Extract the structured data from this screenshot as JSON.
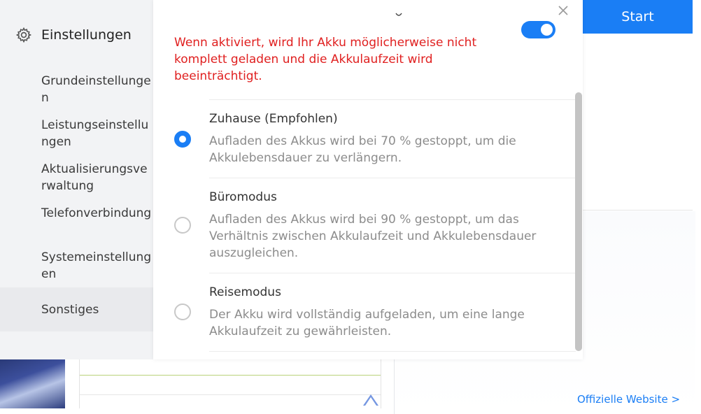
{
  "background": {
    "start_button": "Start",
    "official_link": "Offizielle Website >"
  },
  "sidebar": {
    "title": "Einstellungen",
    "items": [
      {
        "label": "Grundeinstellungen"
      },
      {
        "label": "Leistungseinstellungen"
      },
      {
        "label": "Aktualisierungsverwaltung"
      },
      {
        "label": "Telefonverbindung"
      },
      {
        "label": "Systemeinstellungen"
      },
      {
        "label": "Sonstiges"
      }
    ]
  },
  "panel": {
    "toggle_on": true,
    "warning": "Wenn aktiviert, wird Ihr Akku möglicherweise nicht komplett geladen und die Akkulaufzeit wird beeinträchtigt.",
    "options": [
      {
        "title": "Zuhause (Empfohlen)",
        "description": "Aufladen des Akkus wird bei 70 % gestoppt, um die Akkulebensdauer zu verlängern.",
        "selected": true
      },
      {
        "title": "Büromodus",
        "description": "Aufladen des Akkus wird bei 90 % gestoppt, um das Verhältnis zwischen Akkulaufzeit und Akkulebensdauer auszugleichen.",
        "selected": false
      },
      {
        "title": "Reisemodus",
        "description": "Der Akku wird vollständig aufgeladen, um eine lange Akkulaufzeit zu gewährleisten.",
        "selected": false
      }
    ]
  },
  "colors": {
    "accent": "#1a7ef5",
    "warning": "#e02020"
  }
}
